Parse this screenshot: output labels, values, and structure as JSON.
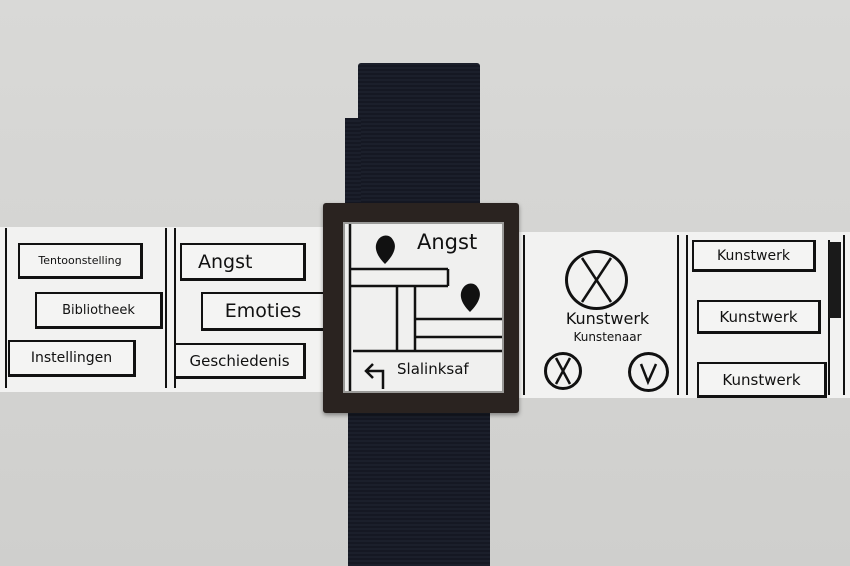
{
  "panels": {
    "menu": {
      "items": [
        {
          "label": "Tentoonstelling"
        },
        {
          "label": "Bibliotheek"
        },
        {
          "label": "Instellingen"
        }
      ]
    },
    "categories": {
      "items": [
        {
          "label": "Angst"
        },
        {
          "label": "Emoties"
        },
        {
          "label": "Geschiedenis"
        }
      ]
    },
    "watch_screen": {
      "title": "Angst",
      "direction": "Slalinksaf",
      "icons": [
        "map-pin-icon",
        "map-pin-icon",
        "arrow-turn-left-icon"
      ]
    },
    "artwork_detail": {
      "artwork": "Kunstwerk",
      "artist": "Kunstenaar",
      "icons": [
        "artwork-placeholder-icon",
        "reject-icon",
        "accept-icon"
      ]
    },
    "artwork_list": {
      "items": [
        {
          "label": "Kunstwerk"
        },
        {
          "label": "Kunstwerk"
        },
        {
          "label": "Kunstwerk"
        }
      ]
    }
  },
  "colors": {
    "ink": "#111111",
    "paper": "#f2f2f1",
    "strap": "#1b1f2b",
    "frame": "#2a2320",
    "background": "#d6d6d4"
  }
}
